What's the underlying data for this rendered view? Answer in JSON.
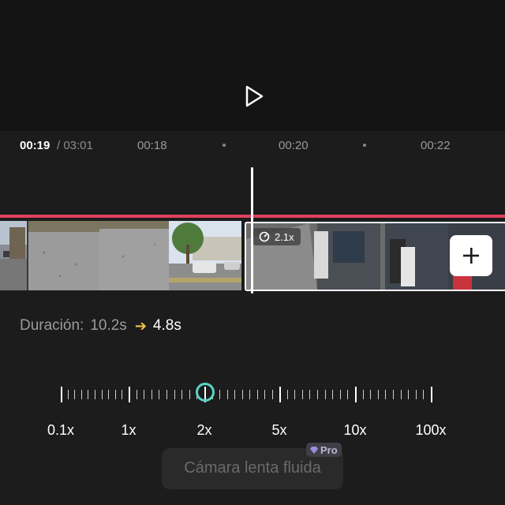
{
  "timeline": {
    "current": "00:19",
    "total": "/ 03:01",
    "marks": [
      "00:18",
      "00:20",
      "00:22"
    ]
  },
  "clip": {
    "speed_tag": "2.1x"
  },
  "duration": {
    "label": "Duración:",
    "from": "10.2s",
    "to": "4.8s"
  },
  "speed_slider": {
    "labels": [
      "0.1x",
      "1x",
      "2x",
      "5x",
      "10x",
      "100x"
    ],
    "selected": "2x"
  },
  "slowmo": {
    "label": "Cámara lenta fluida",
    "badge": "Pro"
  },
  "colors": {
    "accent": "#58d5c5",
    "clip_border": "#e0405d",
    "arrow": "#f2c24a"
  }
}
